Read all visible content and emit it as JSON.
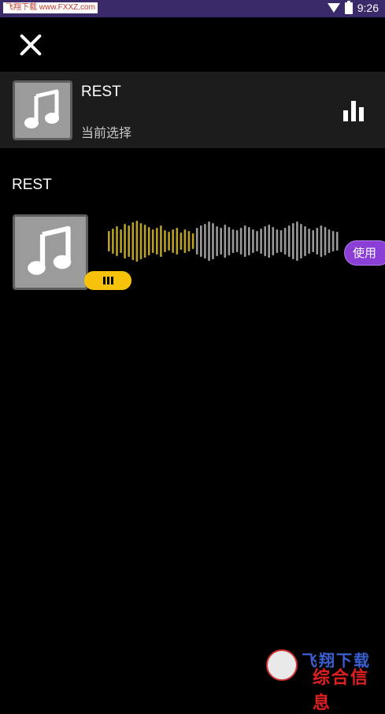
{
  "status_bar": {
    "watermark": "飞翔下载 www.FXXZ.com",
    "time": "9:26",
    "icons": [
      "wifi-icon",
      "battery-icon"
    ]
  },
  "header": {
    "close_icon": "close-icon"
  },
  "current": {
    "title": "REST",
    "subtitle": "当前选择",
    "icon": "music-note-icon",
    "action_icon": "equalizer-bars-icon"
  },
  "section": {
    "title": "REST"
  },
  "item": {
    "icon": "music-note-icon",
    "badge_icon": "playing-bars-icon",
    "use_label": "使用"
  },
  "watermark_logo": {
    "line1": "飞翔下载",
    "line2": "综合信息"
  },
  "colors": {
    "background": "#000000",
    "status_bar": "#3a2a6a",
    "card": "#1c1c1c",
    "accent_purple": "#8b3fd6",
    "accent_yellow": "#f6c30a",
    "wave_played": "#b8a126",
    "wave_unplayed": "#9a9a9a"
  }
}
